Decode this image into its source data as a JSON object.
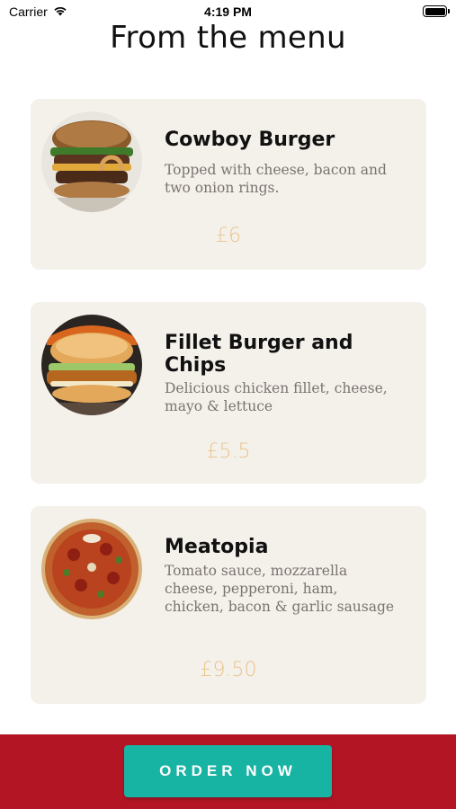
{
  "status_bar": {
    "carrier": "Carrier",
    "time": "4:19 PM",
    "wifi_icon": "wifi-icon",
    "battery_icon": "battery-icon",
    "battery_level": 1.0
  },
  "page": {
    "title": "From the menu"
  },
  "menu": {
    "items": [
      {
        "name": "Cowboy Burger",
        "description": "Topped with cheese, bacon and two onion rings.",
        "price": "£6",
        "image_icon": "burger-photo"
      },
      {
        "name": "Fillet Burger and Chips",
        "description": "Delicious chicken fillet, cheese, mayo & lettuce",
        "price": "£5.5",
        "image_icon": "chicken-burger-photo"
      },
      {
        "name": "Meatopia",
        "description": "Tomato sauce, mozzarella cheese, pepperoni, ham, chicken, bacon & garlic sausage",
        "price": "£9.50",
        "image_icon": "pizza-photo"
      }
    ]
  },
  "footer": {
    "order_label": "ORDER NOW"
  },
  "colors": {
    "card_background": "#f4f0ea",
    "price": "#e8c48c",
    "footer_background": "#b31525",
    "button": "#17b3a3"
  }
}
